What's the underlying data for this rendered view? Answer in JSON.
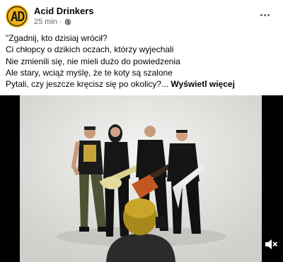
{
  "post": {
    "author": "Acid Drinkers",
    "time": "25 min",
    "separator": "·",
    "lines": [
      "\"Zgadnij, kto dzisiaj wrócił?",
      "Ci chłopcy o dzikich oczach, którzy wyjechali",
      "Nie zmienili się, nie mieli dużo do powiedzenia",
      "Ale stary, wciąż myślę, że te koty są szalone",
      "Pytali, czy jeszcze kręcisz się po okolicy?..."
    ],
    "see_more": "Wyświetl więcej"
  },
  "avatar": {
    "logo_text": "AD",
    "color": "#f0b419"
  },
  "icons": {
    "privacy": "globe-icon",
    "menu": "more-options-icon",
    "sound": "volume-muted-icon"
  }
}
